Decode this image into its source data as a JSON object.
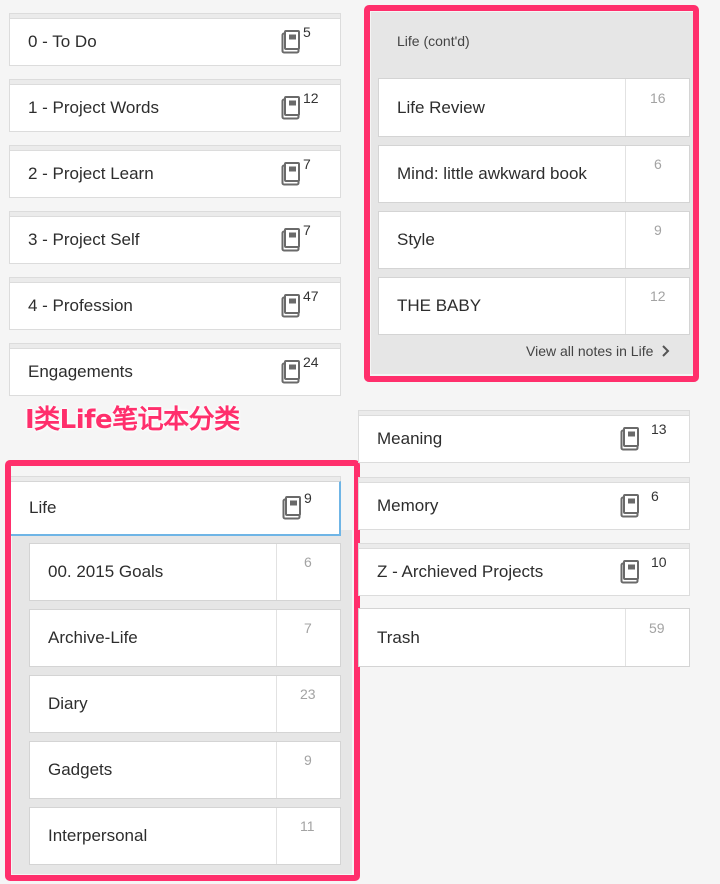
{
  "left_column": [
    {
      "label": "0 - To Do",
      "count": "5"
    },
    {
      "label": "1 - Project Words",
      "count": "12"
    },
    {
      "label": "2 - Project Learn",
      "count": "7"
    },
    {
      "label": "3 - Project Self",
      "count": "7"
    },
    {
      "label": "4 - Profession",
      "count": "47"
    },
    {
      "label": "Engagements",
      "count": "24"
    }
  ],
  "life_stack": {
    "label": "Life",
    "count": "9"
  },
  "life_notebooks": [
    {
      "label": "00. 2015 Goals",
      "count": "6"
    },
    {
      "label": "Archive-Life",
      "count": "7"
    },
    {
      "label": "Diary",
      "count": "23"
    },
    {
      "label": "Gadgets",
      "count": "9"
    },
    {
      "label": "Interpersonal",
      "count": "11"
    }
  ],
  "life_contd": {
    "header": "Life (cont'd)",
    "notebooks": [
      {
        "label": "Life Review",
        "count": "16"
      },
      {
        "label": "Mind: little awkward book",
        "count": "6"
      },
      {
        "label": "Style",
        "count": "9"
      },
      {
        "label": "THE BABY",
        "count": "12"
      }
    ],
    "view_all": "View all notes in Life"
  },
  "right_column": [
    {
      "label": "Meaning",
      "count": "13"
    },
    {
      "label": "Memory",
      "count": "6"
    },
    {
      "label": "Z - Archieved Projects",
      "count": "10"
    }
  ],
  "trash": {
    "label": "Trash",
    "count": "59"
  },
  "annotation": "I类Life笔记本分类",
  "colors": {
    "highlight": "#ff2f6c",
    "selected_border": "#6fb5e6"
  },
  "icons": {
    "stack": "notebook-stack-icon",
    "chevron": "chevron-right-icon"
  }
}
